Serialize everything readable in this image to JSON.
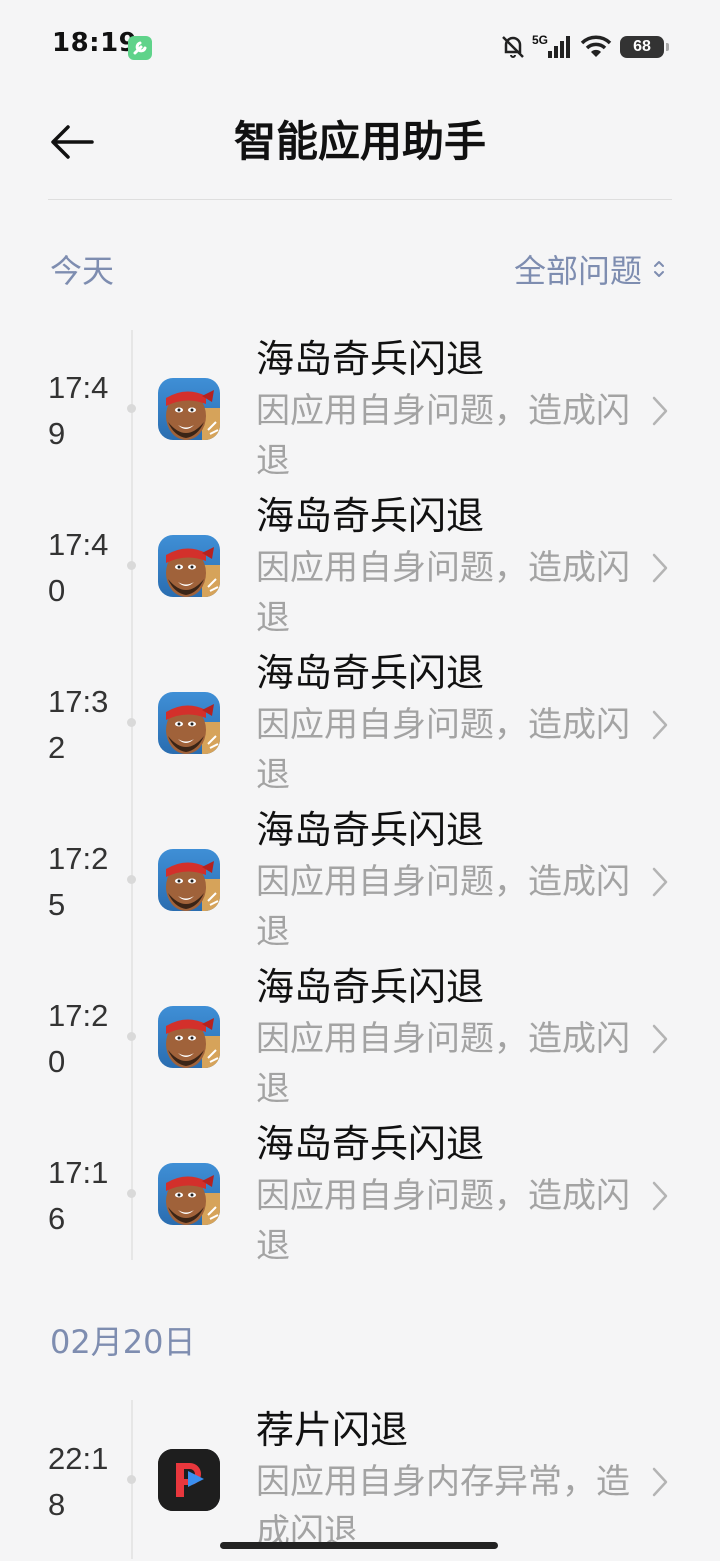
{
  "status_bar": {
    "time": "18:19",
    "network": "5G",
    "battery": "68"
  },
  "header": {
    "title": "智能应用助手"
  },
  "sections": [
    {
      "date_label": "今天",
      "filter_label": "全部问题",
      "items": [
        {
          "time": "17:49",
          "app": "海岛奇兵",
          "title": "海岛奇兵闪退",
          "desc": "因应用自身问题，造成闪退"
        },
        {
          "time": "17:40",
          "app": "海岛奇兵",
          "title": "海岛奇兵闪退",
          "desc": "因应用自身问题，造成闪退"
        },
        {
          "time": "17:32",
          "app": "海岛奇兵",
          "title": "海岛奇兵闪退",
          "desc": "因应用自身问题，造成闪退"
        },
        {
          "time": "17:25",
          "app": "海岛奇兵",
          "title": "海岛奇兵闪退",
          "desc": "因应用自身问题，造成闪退"
        },
        {
          "time": "17:20",
          "app": "海岛奇兵",
          "title": "海岛奇兵闪退",
          "desc": "因应用自身问题，造成闪退"
        },
        {
          "time": "17:16",
          "app": "海岛奇兵",
          "title": "海岛奇兵闪退",
          "desc": "因应用自身问题，造成闪退"
        }
      ]
    },
    {
      "date_label": "02月20日",
      "items": [
        {
          "time": "22:18",
          "app": "荐片",
          "title": "荐片闪退",
          "desc": "因应用自身内存异常，造成闪退"
        }
      ]
    }
  ],
  "colors": {
    "background": "#f5f5f6",
    "section_label": "#7e8db0",
    "secondary_text": "#a3a3a3"
  },
  "icons": {
    "back": "back-arrow-icon",
    "filter": "sort-updown-icon",
    "chevron": "chevron-right-icon",
    "boom_beach": "boom-beach-app-icon",
    "jianpian": "jianpian-app-icon"
  }
}
